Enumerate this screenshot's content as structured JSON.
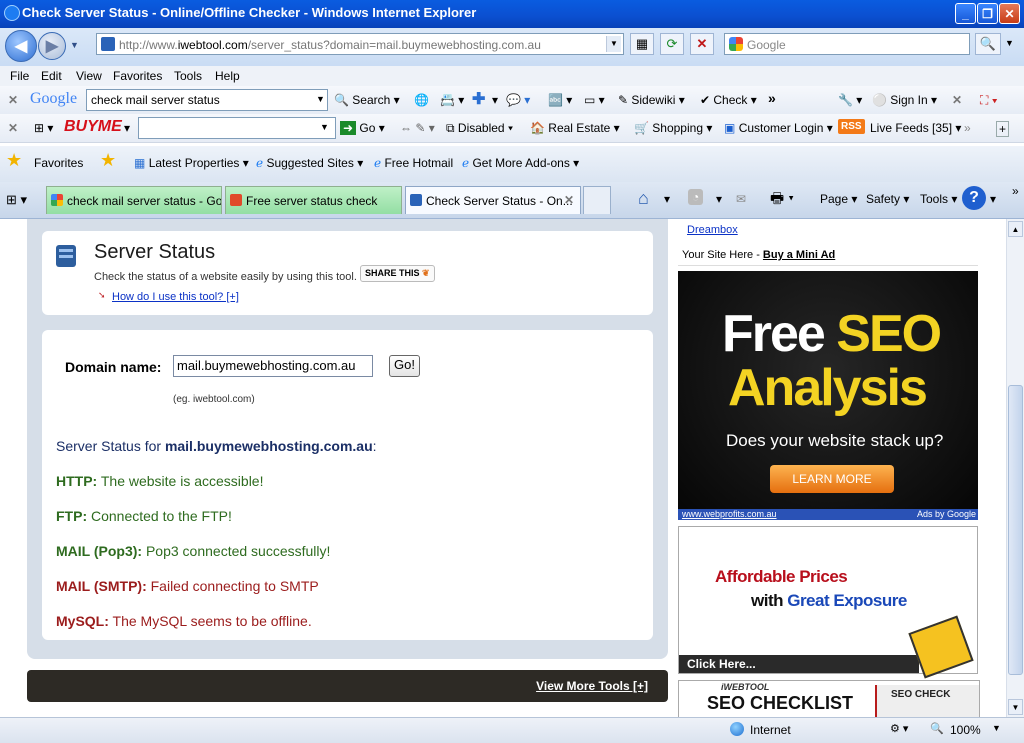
{
  "window": {
    "title": "Check Server Status - Online/Offline Checker - Windows Internet Explorer"
  },
  "nav": {
    "url_prefix": "http://www.",
    "url_domain": "iwebtool.com",
    "url_rest": "/server_status?domain=mail.buymewebhosting.com.au",
    "search_placeholder": "Google"
  },
  "menu": [
    "File",
    "Edit",
    "View",
    "Favorites",
    "Tools",
    "Help"
  ],
  "google_toolbar": {
    "logo": "Google",
    "query": "check mail server status",
    "search_label": "Search",
    "sidewiki_label": "Sidewiki",
    "check_label": "Check",
    "more": "»",
    "signin_label": "Sign In"
  },
  "buyme_toolbar": {
    "logo": "BUYME",
    "go_label": "Go",
    "disabled_label": "Disabled",
    "real_estate_label": "Real Estate",
    "shopping_label": "Shopping",
    "customer_login_label": "Customer Login",
    "rss_badge": "RSS",
    "live_feeds_label": "Live Feeds [35]"
  },
  "favorites_bar": {
    "favorites_label": "Favorites",
    "items": [
      "Latest Properties",
      "Suggested Sites",
      "Free Hotmail",
      "Get More Add-ons"
    ]
  },
  "tabs": [
    {
      "label": "check mail server status - Go..."
    },
    {
      "label": "Free server status check"
    },
    {
      "label": "Check Server Status - On..."
    }
  ],
  "command_bar": {
    "page_label": "Page",
    "safety_label": "Safety",
    "tools_label": "Tools"
  },
  "tool": {
    "title": "Server Status",
    "description": "Check the status of a website easily by using this tool.",
    "share_label": "SHARE THIS",
    "howto_link": "How do I use this tool? [+]",
    "domain_label": "Domain name:",
    "domain_value": "mail.buymewebhosting.com.au",
    "go_button": "Go!",
    "example": "(eg. iwebtool.com)",
    "status_for_prefix": "Server Status for ",
    "status_for_domain": "mail.buymewebhosting.com.au",
    "status_for_suffix": ":",
    "results": [
      {
        "label": "HTTP:",
        "text": "The website is accessible!",
        "color": "#2e6b1f"
      },
      {
        "label": "FTP:",
        "text": "Connected to the FTP!",
        "color": "#2e6b1f"
      },
      {
        "label": "MAIL (Pop3):",
        "text": "Pop3 connected successfully!",
        "color": "#2e6b1f"
      },
      {
        "label": "MAIL (SMTP):",
        "text": "Failed connecting to SMTP",
        "color": "#9b1c1c"
      },
      {
        "label": "MySQL:",
        "text": "The MySQL seems to be offline.",
        "color": "#9b1c1c"
      }
    ],
    "more_tools_link": "View More Tools [+]"
  },
  "sidebar": {
    "dreambox_link": "Dreambox",
    "your_site_here": "Your Site Here - ",
    "buy_mini_ad": "Buy a Mini Ad",
    "ad1": {
      "line1a": "Free ",
      "line1b": "SEO",
      "line2": "Analysis",
      "tagline": "Does your website stack up?",
      "button": "LEARN MORE",
      "footer_left": "www.webprofits.com.au",
      "footer_right": "Ads by Google"
    },
    "ad2": {
      "line1": "Affordable Prices",
      "line2a": "with ",
      "line2b": "Great Exposure",
      "click": "Click Here..."
    },
    "ad3": {
      "brand": "iWEBTOOL",
      "text": "SEO CHECKLIST",
      "side_text": "SEO CHECK"
    }
  },
  "status": {
    "zone": "Internet",
    "zoom": "100%"
  }
}
